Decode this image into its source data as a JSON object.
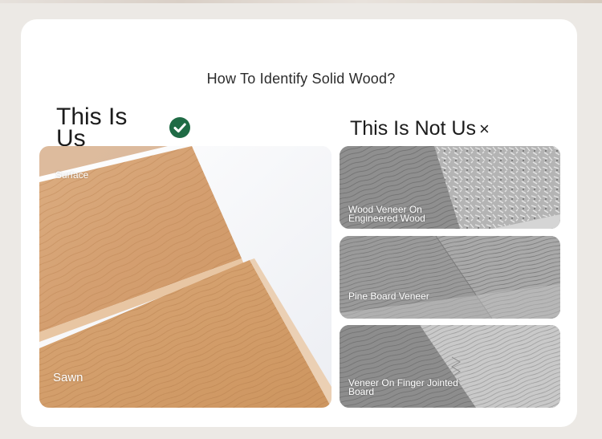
{
  "heading": "How To Identify Solid Wood?",
  "this_is_us": {
    "title": "This Is Us",
    "icon": "check-circle-icon",
    "accent": "#1f6b45",
    "labels": {
      "surface": "Surface",
      "sawn": "Sawn"
    }
  },
  "not_us": {
    "title": "This Is Not Us",
    "mark": "×",
    "items": [
      {
        "label": "Wood Veneer On Engineered Wood"
      },
      {
        "label": "Pine Board Veneer"
      },
      {
        "label": "Veneer On Finger Jointed Board"
      }
    ]
  },
  "colors": {
    "background": "#ece9e5",
    "card": "#ffffff",
    "wood": "#d6a57a",
    "text": "#1c1c1c"
  }
}
